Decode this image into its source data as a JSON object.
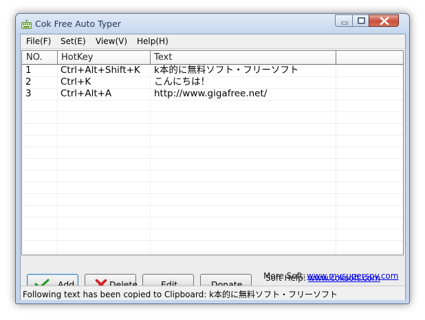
{
  "window": {
    "title": "Cok Free Auto Typer"
  },
  "menu": [
    {
      "label": "File(F)"
    },
    {
      "label": "Set(E)"
    },
    {
      "label": "View(V)"
    },
    {
      "label": "Help(H)"
    }
  ],
  "list": {
    "columns": [
      "NO.",
      "HotKey",
      "Text"
    ],
    "rows": [
      {
        "no": "1",
        "hotkey": "Ctrl+Alt+Shift+K",
        "text": "k本的に無料ソフト・フリーソフト"
      },
      {
        "no": "2",
        "hotkey": "Ctrl+K",
        "text": "こんにちは！"
      },
      {
        "no": "3",
        "hotkey": "Ctrl+Alt+A",
        "text": "http://www.gigafree.net/"
      }
    ]
  },
  "buttons": {
    "add": "Add",
    "delete": "Delete",
    "edit": "Edit",
    "donate": "Donate"
  },
  "help": {
    "soft_help_label": "Soft Help:",
    "soft_help_link": "www.coksoft.com",
    "more_soft_label": "More Soft:",
    "more_soft_link": "www.mysuperspy.com"
  },
  "status": {
    "text": "Following text has been copied to Clipboard: k本的に無料ソフト・フリーソフト"
  },
  "colors": {
    "window_frame": "#c4d5ec",
    "link": "#0000ee",
    "close_button": "#c9503b"
  }
}
